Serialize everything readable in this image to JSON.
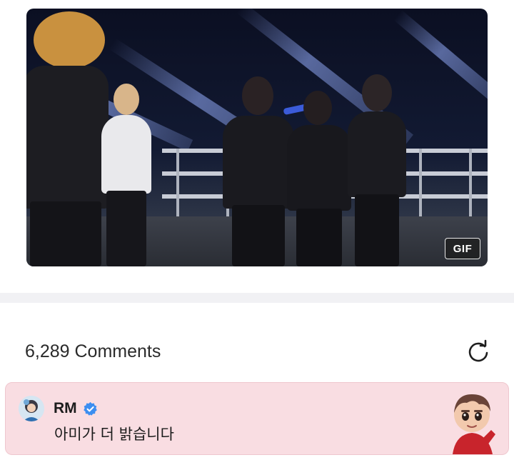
{
  "media": {
    "badge_label": "GIF"
  },
  "comments": {
    "count_label": "6,289 Comments",
    "refresh_icon": "refresh-icon"
  },
  "pinned_comment": {
    "author": "RM",
    "verified_icon": "verified-badge-icon",
    "text": "아미가 더 밝습니다",
    "background_color": "#f9dde2"
  },
  "colors": {
    "verified_blue": "#3d8ef0",
    "divider": "#f1f1f4",
    "text": "#2a2a2a"
  }
}
